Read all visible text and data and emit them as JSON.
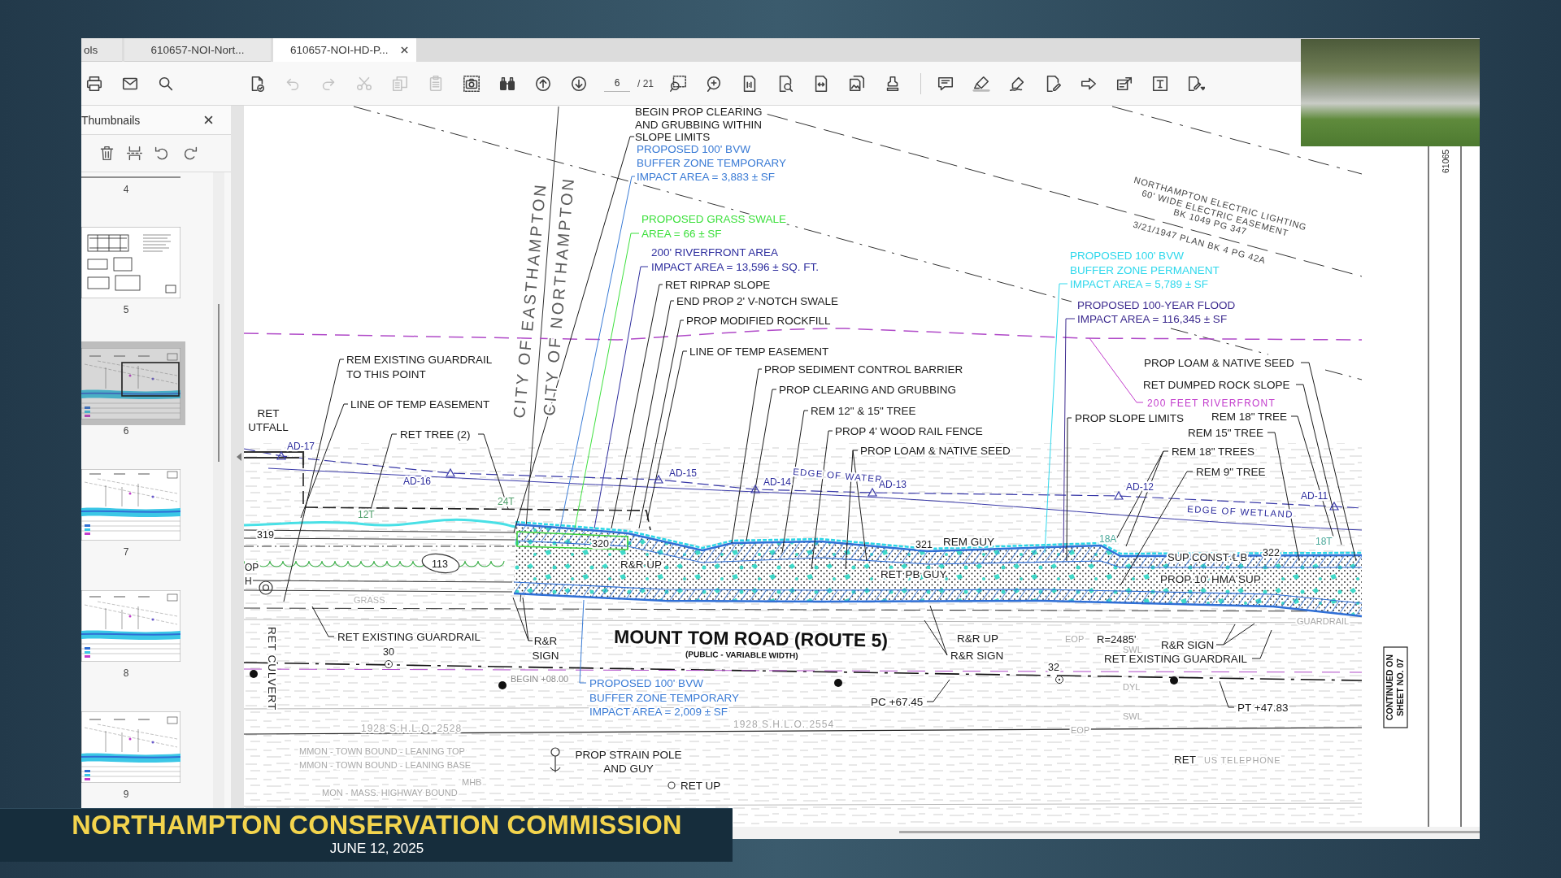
{
  "window": {
    "tabs": [
      {
        "label": "ols",
        "selected": false
      },
      {
        "label": "610657-NOI-Nort...",
        "selected": false
      },
      {
        "label": "610657-NOI-HD-P...",
        "selected": true
      }
    ]
  },
  "toolbar": {
    "buttons": [
      {
        "disabled": false
      },
      {
        "disabled": false
      },
      {
        "disabled": false
      },
      {
        "disabled": false
      },
      {
        "disabled": true
      },
      {
        "disabled": true
      },
      {
        "disabled": true
      },
      {
        "disabled": true
      },
      {
        "disabled": true
      },
      {
        "disabled": false
      },
      {
        "disabled": false
      },
      {
        "disabled": false
      },
      {
        "disabled": false
      },
      {
        "disabled": false
      },
      {
        "disabled": false
      },
      {
        "disabled": false
      },
      {
        "disabled": false
      },
      {
        "disabled": false
      },
      {
        "disabled": false
      },
      {
        "disabled": false
      },
      {
        "disabled": false
      },
      {
        "disabled": false
      },
      {
        "disabled": false
      },
      {
        "disabled": false
      },
      {
        "disabled": false
      },
      {
        "disabled": false
      },
      {
        "disabled": false
      },
      {
        "disabled": false
      }
    ],
    "page_field": {
      "value": "6"
    },
    "page_count": "/ 21"
  },
  "sidebar": {
    "title": "Thumbnails",
    "pages": [
      {
        "label": "4",
        "selected": false
      },
      {
        "label": "5",
        "selected": false
      },
      {
        "label": "6",
        "selected": true
      },
      {
        "label": "7",
        "selected": false
      },
      {
        "label": "8",
        "selected": false
      },
      {
        "label": "9",
        "selected": false
      }
    ]
  },
  "plan": {
    "callouts": [
      {
        "lines": [
          "BEGIN PROP CLEARING",
          "AND GRUBBING WITHIN",
          "SLOPE LIMITS"
        ],
        "color": "#1a1a1a"
      },
      {
        "lines": [
          "PROPOSED 100' BVW",
          "BUFFER ZONE TEMPORARY",
          "IMPACT AREA = 3,883 ± SF"
        ],
        "color": "#3a7bd5"
      },
      {
        "lines": [
          "PROPOSED GRASS SWALE",
          "AREA = 66 ± SF"
        ],
        "color": "#3ee03e"
      },
      {
        "lines": [
          "200' RIVERFRONT AREA",
          "IMPACT AREA = 13,596 ± SQ. FT."
        ],
        "color": "#2e2e9e"
      },
      {
        "lines": [
          "RET RIPRAP SLOPE"
        ],
        "color": "#1a1a1a"
      },
      {
        "lines": [
          "END PROP 2' V-NOTCH SWALE"
        ],
        "color": "#1a1a1a"
      },
      {
        "lines": [
          "PROP MODIFIED ROCKFILL"
        ],
        "color": "#1a1a1a"
      },
      {
        "lines": [
          "LINE OF TEMP EASEMENT"
        ],
        "color": "#1a1a1a"
      },
      {
        "lines": [
          "PROP SEDIMENT CONTROL BARRIER"
        ],
        "color": "#1a1a1a"
      },
      {
        "lines": [
          "PROP CLEARING AND GRUBBING"
        ],
        "color": "#1a1a1a"
      },
      {
        "lines": [
          "REM 12\" & 15\" TREE"
        ],
        "color": "#1a1a1a"
      },
      {
        "lines": [
          "PROP 4' WOOD RAIL FENCE"
        ],
        "color": "#1a1a1a"
      },
      {
        "lines": [
          "PROP LOAM & NATIVE SEED"
        ],
        "color": "#1a1a1a"
      },
      {
        "lines": [
          "REM EXISTING GUARDRAIL",
          "TO THIS POINT"
        ],
        "color": "#1a1a1a"
      },
      {
        "lines": [
          "LINE OF TEMP EASEMENT"
        ],
        "color": "#1a1a1a"
      },
      {
        "lines": [
          "RET",
          "UTFALL"
        ],
        "color": "#1a1a1a"
      },
      {
        "lines": [
          "RET TREE (2)"
        ],
        "color": "#1a1a1a"
      },
      {
        "lines": [
          "PROPOSED 100' BVW",
          "BUFFER ZONE PERMANENT",
          "IMPACT AREA = 5,789 ± SF"
        ],
        "color": "#30d8ec"
      },
      {
        "lines": [
          "PROPOSED 100-YEAR FLOOD",
          "IMPACT AREA = 116,345 ± SF"
        ],
        "color": "#3d2b8f"
      },
      {
        "lines": [
          "PROP LOAM & NATIVE SEED"
        ],
        "color": "#1a1a1a"
      },
      {
        "lines": [
          "RET DUMPED ROCK SLOPE"
        ],
        "color": "#1a1a1a"
      },
      {
        "lines": [
          "200 FEET RIVERFRONT"
        ],
        "color": "#c23ccc"
      },
      {
        "lines": [
          "PROP SLOPE LIMITS"
        ],
        "color": "#1a1a1a"
      },
      {
        "lines": [
          "REM 18\" TREE"
        ],
        "color": "#1a1a1a"
      },
      {
        "lines": [
          "REM 15\" TREE"
        ],
        "color": "#1a1a1a"
      },
      {
        "lines": [
          "REM 18\" TREES"
        ],
        "color": "#1a1a1a"
      },
      {
        "lines": [
          "REM 9\" TREE"
        ],
        "color": "#1a1a1a"
      },
      {
        "lines": [
          "RET EXISTING GUARDRAIL"
        ],
        "color": "#1a1a1a"
      },
      {
        "lines": [
          "R&R",
          "SIGN"
        ],
        "color": "#1a1a1a"
      },
      {
        "lines": [
          "PROPOSED 100' BVW",
          "BUFFER ZONE TEMPORARY",
          "IMPACT AREA = 2,009 ± SF"
        ],
        "color": "#3a7bd5"
      },
      {
        "lines": [
          "PROP STRAIN POLE",
          "AND GUY"
        ],
        "color": "#1a1a1a"
      },
      {
        "lines": [
          "RET UP"
        ],
        "color": "#1a1a1a"
      },
      {
        "lines": [
          "REM GUY"
        ],
        "color": "#1a1a1a"
      },
      {
        "lines": [
          "RET PB GUY"
        ],
        "color": "#1a1a1a"
      },
      {
        "lines": [
          "R&R UP"
        ],
        "color": "#1a1a1a"
      },
      {
        "lines": [
          "R&R SIGN"
        ],
        "color": "#1a1a1a"
      },
      {
        "lines": [
          "R&R SIGN"
        ],
        "color": "#1a1a1a"
      },
      {
        "lines": [
          "RET EXISTING GUARDRAIL"
        ],
        "color": "#1a1a1a"
      },
      {
        "lines": [
          "PC +67.45"
        ],
        "color": "#1a1a1a"
      },
      {
        "lines": [
          "PT +47.83"
        ],
        "color": "#1a1a1a"
      },
      {
        "lines": [
          "SUP CONST ℄ B"
        ],
        "color": "#1a1a1a"
      },
      {
        "lines": [
          "PROP 10' HMA SUP"
        ],
        "color": "#1a1a1a"
      },
      {
        "lines": [
          "R&R UP"
        ],
        "color": "#1a1a1a"
      },
      {
        "lines": [
          "RET"
        ],
        "color": "#1a1a1a"
      }
    ],
    "survey_labels": [
      {
        "text": "AD-17",
        "color": "#2e2e9e"
      },
      {
        "text": "AD-16",
        "color": "#2e2e9e"
      },
      {
        "text": "AD-15",
        "color": "#2e2e9e"
      },
      {
        "text": "AD-14",
        "color": "#2e2e9e"
      },
      {
        "text": "EDGE OF WATER",
        "color": "#2e2e9e"
      },
      {
        "text": "AD-13",
        "color": "#2e2e9e"
      },
      {
        "text": "AD-12",
        "color": "#2e2e9e"
      },
      {
        "text": "EDGE OF WETLAND",
        "color": "#2e2e9e"
      },
      {
        "text": "AD-11",
        "color": "#2e2e9e"
      },
      {
        "text": "12T",
        "color": "#4e9e6a"
      },
      {
        "text": "24T",
        "color": "#4e9e6a"
      },
      {
        "text": "18A",
        "color": "#4aa89a"
      },
      {
        "text": "18T",
        "color": "#4aa89a"
      },
      {
        "text": "319",
        "color": "#1a1a1a"
      },
      {
        "text": "320",
        "color": "#1a1a1a"
      },
      {
        "text": "113",
        "color": "#1a1a1a"
      },
      {
        "text": "321",
        "color": "#1a1a1a"
      },
      {
        "text": "322",
        "color": "#1a1a1a"
      },
      {
        "text": "30",
        "color": "#1a1a1a"
      },
      {
        "text": "32",
        "color": "#1a1a1a"
      },
      {
        "text": "R=2485'",
        "color": "#1a1a1a"
      },
      {
        "text": "EOP",
        "color": "#a8a8a8"
      },
      {
        "text": "SWL",
        "color": "#a8a8a8"
      },
      {
        "text": "DYL",
        "color": "#a8a8a8"
      },
      {
        "text": "SWL",
        "color": "#a8a8a8"
      },
      {
        "text": "EOP",
        "color": "#a8a8a8"
      },
      {
        "text": "GRASS",
        "color": "#b4b4b4"
      },
      {
        "text": "GUARDRAIL",
        "color": "#a8a8a8"
      },
      {
        "text": "1928 S.H.L.O. 2528",
        "color": "#a8a8a8"
      },
      {
        "text": "1928 S.H.L.O. 2554",
        "color": "#a8a8a8"
      },
      {
        "text": "MMON - TOWN BOUND - LEANING TOP",
        "color": "#a8a8a8"
      },
      {
        "text": "MMON - TOWN BOUND - LEANING BASE",
        "color": "#a8a8a8"
      },
      {
        "text": "MHB",
        "color": "#a8a8a8"
      },
      {
        "text": "MON - MASS. HIGHWAY BOUND",
        "color": "#a8a8a8"
      },
      {
        "text": "US TELEPHONE",
        "color": "#a8a8a8"
      },
      {
        "text": "BEGIN +08.00",
        "color": "#8a8a8a"
      },
      {
        "text": "OP",
        "color": "#1a1a1a"
      },
      {
        "text": "H",
        "color": "#1a1a1a"
      }
    ],
    "town_lines": [
      "CITY OF EASTHAMPTON",
      "CITY OF NORTHAMPTON"
    ],
    "culvert_label": "RET CULVERT",
    "easement_note": [
      "NORTHAMPTON ELECTRIC LIGHTING",
      "60' WIDE ELECTRIC EASEMENT",
      "BK 1049 PG 347",
      "3/21/1947 PLAN BK 4 PG 42A"
    ],
    "road_name": "MOUNT TOM ROAD (ROUTE 5)",
    "road_width_note": "(PUBLIC - VARIABLE WIDTH)",
    "continued_note": [
      "CONTINUED ON",
      "SHEET NO. 07"
    ],
    "sheet_id": "61065"
  },
  "caption": {
    "title": "NORTHAMPTON CONSERVATION COMMISSION",
    "date": "JUNE 12, 2025"
  }
}
